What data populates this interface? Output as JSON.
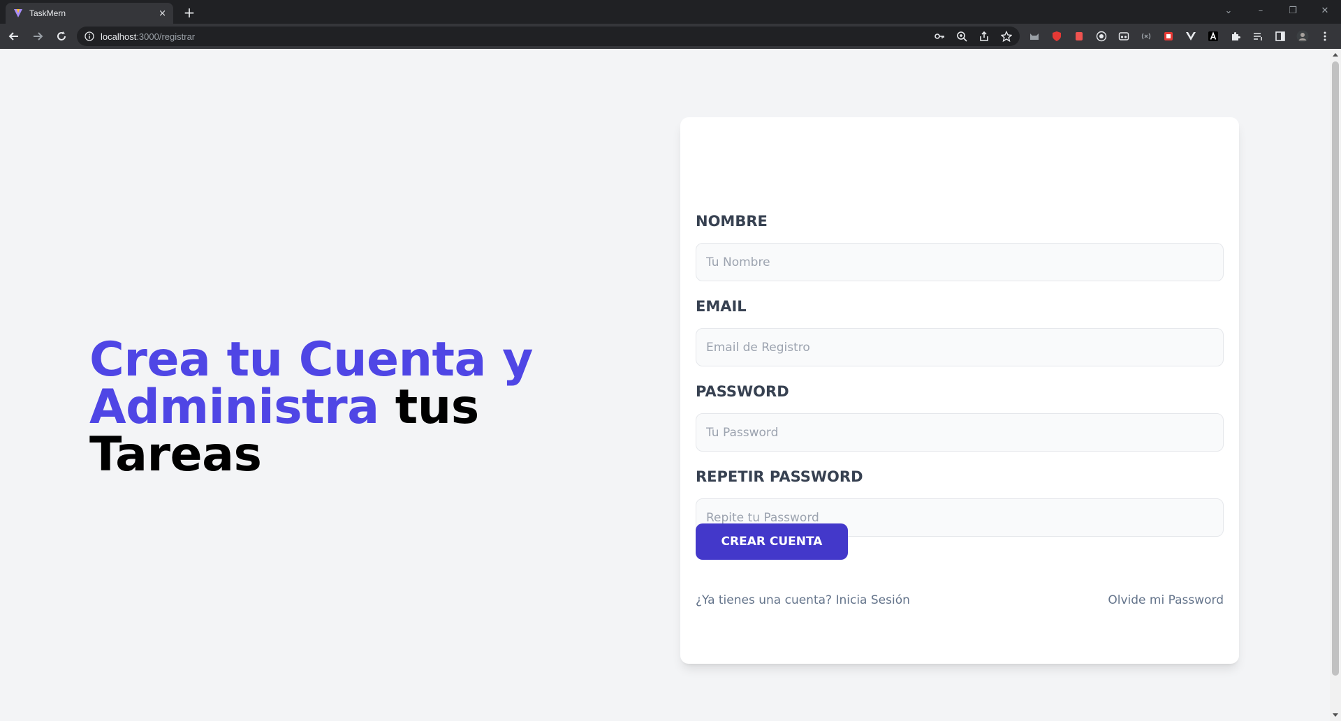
{
  "browser": {
    "tab_title": "TaskMern",
    "tab_close": "×",
    "new_tab": "+",
    "url_host": "localhost",
    "url_path": ":3000/registrar",
    "window_controls": [
      "⌄",
      "–",
      "❐",
      "✕"
    ]
  },
  "hero": {
    "accent_text": "Crea tu Cuenta y Administra",
    "dark_text": "tus Tareas",
    "accent_color": "#4f46e5"
  },
  "form": {
    "fields": [
      {
        "label": "NOMBRE",
        "placeholder": "Tu Nombre",
        "value": ""
      },
      {
        "label": "EMAIL",
        "placeholder": "Email de Registro",
        "value": ""
      },
      {
        "label": "PASSWORD",
        "placeholder": "Tu Password",
        "value": ""
      },
      {
        "label": "REPETIR PASSWORD",
        "placeholder": "Repite tu Password",
        "value": ""
      }
    ],
    "submit_label": "CREAR CUENTA",
    "submit_color": "#4338ca",
    "login_link": "¿Ya tienes una cuenta? Inicia Sesión",
    "forgot_link": "Olvide mi Password"
  }
}
